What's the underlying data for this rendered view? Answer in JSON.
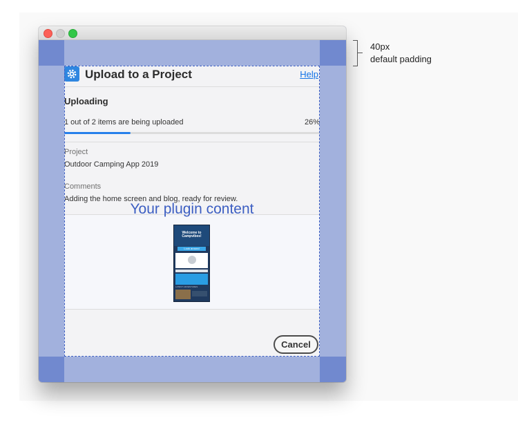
{
  "dialog": {
    "title": "Upload to a Project",
    "help_label": "Help",
    "section_title": "Uploading",
    "status_text": "1 out of 2 items are being uploaded",
    "progress_percent_label": "26%",
    "progress_fraction": 0.26,
    "project_label": "Project",
    "project_value": "Outdoor Camping App 2019",
    "comments_label": "Comments",
    "comments_value": "Adding the home screen and blog, ready for review.",
    "preview": {
      "app_title": "Welcome to Campvibes!",
      "button_label": "Look around",
      "section_label": "LATEST ADVENTURES"
    },
    "cancel_label": "Cancel"
  },
  "overlay": {
    "plugin_content_label": "Your plugin content"
  },
  "annotation": {
    "size": "40px",
    "description": "default padding"
  },
  "colors": {
    "padding": "#a2b1dd",
    "corner": "#7189cf",
    "dashed_outline": "#3c5ec2",
    "progress": "#2680eb",
    "help_link": "#1473e6"
  },
  "icons": {
    "header": "gear-icon"
  }
}
